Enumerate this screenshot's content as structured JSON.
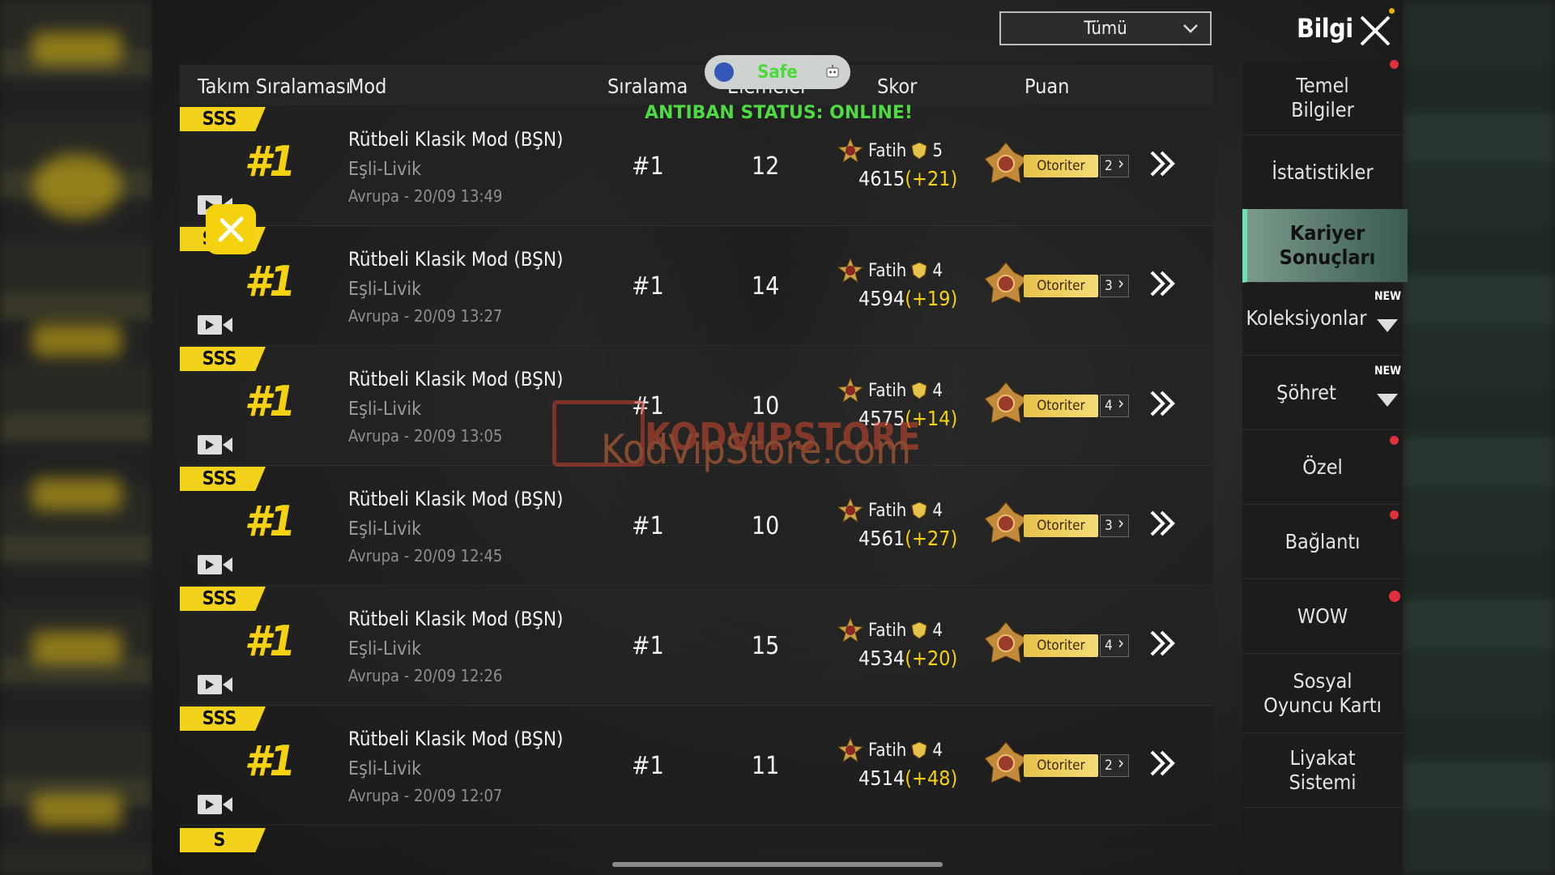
{
  "filter": {
    "selected": "Tümü"
  },
  "header": {
    "title": "Bilgi"
  },
  "columns": {
    "team_rank": "Takım Sıralaması",
    "mode": "Mod",
    "rank": "Sıralama",
    "eliminations": "Elemeler",
    "score": "Skor",
    "points": "Puan"
  },
  "overlay": {
    "safe_label": "Safe",
    "antiban": "ANTIBAN STATUS: ONLINE!"
  },
  "watermark": {
    "brand": "KODVIPSTORE",
    "url": "KodVipStore.com"
  },
  "matches": [
    {
      "badge": "SSS",
      "team_rank": "#1",
      "mode": "Rütbeli Klasik Mod (BŞN)",
      "squad": "Eşli-Livik",
      "region_time": "Avrupa - 20/09 13:49",
      "rank": "#1",
      "elims": "12",
      "player": "Fatih",
      "level": "5",
      "score": "4615",
      "delta": "(+21)",
      "tier": "Otoriter",
      "tier_count": "2"
    },
    {
      "badge": "SSS",
      "team_rank": "#1",
      "mode": "Rütbeli Klasik Mod (BŞN)",
      "squad": "Eşli-Livik",
      "region_time": "Avrupa - 20/09 13:27",
      "rank": "#1",
      "elims": "14",
      "player": "Fatih",
      "level": "4",
      "score": "4594",
      "delta": "(+19)",
      "tier": "Otoriter",
      "tier_count": "3"
    },
    {
      "badge": "SSS",
      "team_rank": "#1",
      "mode": "Rütbeli Klasik Mod (BŞN)",
      "squad": "Eşli-Livik",
      "region_time": "Avrupa - 20/09 13:05",
      "rank": "#1",
      "elims": "10",
      "player": "Fatih",
      "level": "4",
      "score": "4575",
      "delta": "(+14)",
      "tier": "Otoriter",
      "tier_count": "4"
    },
    {
      "badge": "SSS",
      "team_rank": "#1",
      "mode": "Rütbeli Klasik Mod (BŞN)",
      "squad": "Eşli-Livik",
      "region_time": "Avrupa - 20/09 12:45",
      "rank": "#1",
      "elims": "10",
      "player": "Fatih",
      "level": "4",
      "score": "4561",
      "delta": "(+27)",
      "tier": "Otoriter",
      "tier_count": "3"
    },
    {
      "badge": "SSS",
      "team_rank": "#1",
      "mode": "Rütbeli Klasik Mod (BŞN)",
      "squad": "Eşli-Livik",
      "region_time": "Avrupa - 20/09 12:26",
      "rank": "#1",
      "elims": "15",
      "player": "Fatih",
      "level": "4",
      "score": "4534",
      "delta": "(+20)",
      "tier": "Otoriter",
      "tier_count": "4"
    },
    {
      "badge": "SSS",
      "team_rank": "#1",
      "mode": "Rütbeli Klasik Mod (BŞN)",
      "squad": "Eşli-Livik",
      "region_time": "Avrupa - 20/09 12:07",
      "rank": "#1",
      "elims": "11",
      "player": "Fatih",
      "level": "4",
      "score": "4514",
      "delta": "(+48)",
      "tier": "Otoriter",
      "tier_count": "2"
    }
  ],
  "trailing_badge": "S",
  "sidebar": {
    "items": [
      {
        "label": "Temel Bilgiler"
      },
      {
        "label": "İstatistikler"
      },
      {
        "label": "Kariyer Sonuçları",
        "active": true
      },
      {
        "label": "Koleksiyonlar",
        "badge": "NEW"
      },
      {
        "label": "Şöhret",
        "badge": "NEW"
      },
      {
        "label": "Özel"
      },
      {
        "label": "Bağlantı"
      },
      {
        "label": "WOW"
      },
      {
        "label": "Sosyal Oyuncu Kartı"
      },
      {
        "label": "Liyakat Sistemi"
      }
    ]
  },
  "colors": {
    "accent": "#f5d20f",
    "delta": "#f5d20f",
    "status": "#4fd942",
    "notification": "#e0303c"
  }
}
